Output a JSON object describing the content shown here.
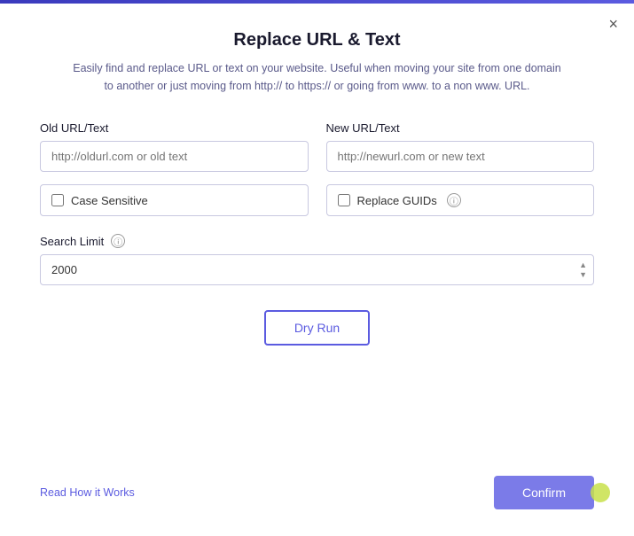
{
  "topbar": {},
  "dialog": {
    "title": "Replace URL & Text",
    "subtitle": "Easily find and replace URL or text on your website. Useful when moving your site from one domain to another or just moving from http:// to https:// or going from www. to a non www. URL.",
    "close_label": "×",
    "old_url_label": "Old URL/Text",
    "old_url_placeholder": "http://oldurl.com or old text",
    "new_url_label": "New URL/Text",
    "new_url_placeholder": "http://newurl.com or new text",
    "case_sensitive_label": "Case Sensitive",
    "replace_guids_label": "Replace GUIDs",
    "search_limit_label": "Search Limit",
    "search_limit_info": "ⓘ",
    "search_limit_value": "2000",
    "dry_run_label": "Dry Run",
    "read_link_label": "Read How it Works",
    "confirm_label": "Confirm"
  }
}
